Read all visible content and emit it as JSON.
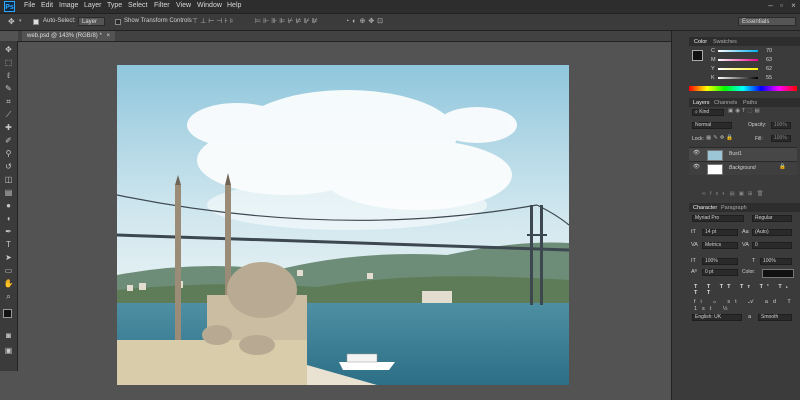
{
  "menubar": {
    "logo": "Ps",
    "items": [
      "File",
      "Edit",
      "Image",
      "Layer",
      "Type",
      "Select",
      "Filter",
      "View",
      "Window",
      "Help"
    ]
  },
  "options": {
    "auto_select_label": "Auto-Select:",
    "layer_dropdown": "Layer",
    "show_transform_label": "Show Transform Controls",
    "workspace": "Essentials"
  },
  "document": {
    "tab_title": "web.psd @ 143% (RGB/8) *"
  },
  "color_panel": {
    "tabs": [
      "Color",
      "Swatches"
    ],
    "channels": [
      {
        "label": "C",
        "value": "70"
      },
      {
        "label": "M",
        "value": "63"
      },
      {
        "label": "Y",
        "value": "62"
      },
      {
        "label": "K",
        "value": "55"
      }
    ]
  },
  "layers_panel": {
    "tabs": [
      "Layers",
      "Channels",
      "Paths"
    ],
    "kind_label": "Kind",
    "blend_mode": "Normal",
    "opacity_label": "Opacity:",
    "opacity_value": "100%",
    "lock_label": "Lock:",
    "fill_label": "Fill:",
    "fill_value": "100%",
    "layers": [
      {
        "name": "Bust1"
      },
      {
        "name": "Background"
      }
    ]
  },
  "character_panel": {
    "tabs": [
      "Character",
      "Paragraph"
    ],
    "font_family": "Myriad Pro",
    "font_style": "Regular",
    "size": "14 pt",
    "leading": "(Auto)",
    "kerning": "Metrics",
    "tracking": "0",
    "vscale": "100%",
    "hscale": "100%",
    "baseline": "0 pt",
    "color_label": "Color:",
    "language": "English: UK",
    "aa": "Smooth",
    "aa_label": "a"
  }
}
